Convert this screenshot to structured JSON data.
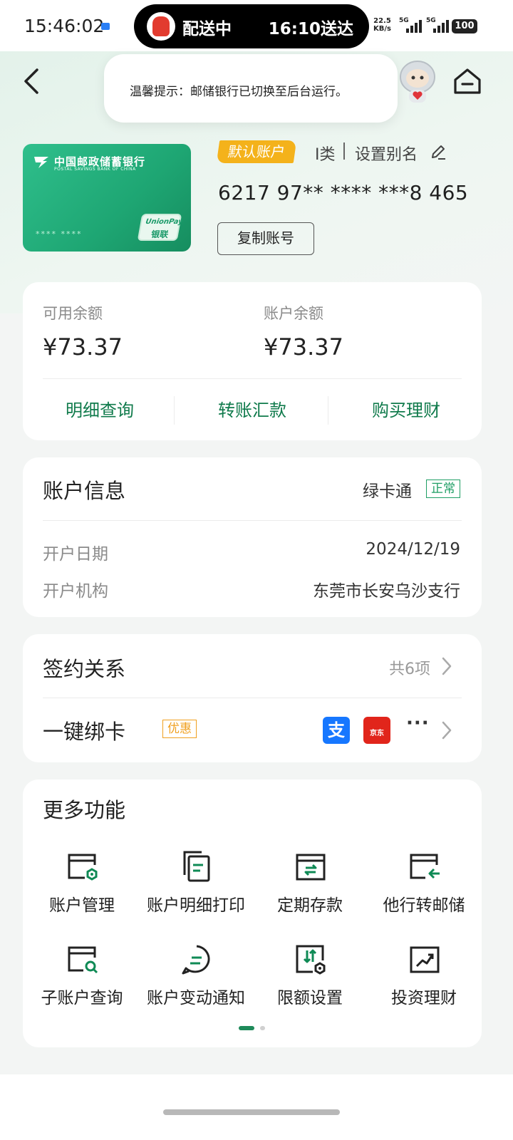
{
  "status_bar": {
    "time": "15:46:02",
    "delivery_label": "配送中",
    "delivery_eta": "16:10送达",
    "net_speed_value": "22.5",
    "net_speed_unit": "KB/s",
    "signal_1": "5G",
    "signal_2": "5G",
    "battery": "100"
  },
  "toast": {
    "text": "温馨提示：邮储银行已切换至后台运行。"
  },
  "card": {
    "bank_name": "中国邮政储蓄银行",
    "bank_name_en": "POSTAL SAVINGS BANK OF CHINA",
    "masked_digits": "**** ****",
    "unionpay_en": "UnionPay",
    "unionpay_cn": "银联",
    "default_badge": "默认账户",
    "account_class": "I类",
    "alias_link": "设置别名",
    "account_number": "6217 97** **** ***8 465",
    "copy_button": "复制账号"
  },
  "balance": {
    "available_label": "可用余额",
    "available_value": "¥73.37",
    "account_label": "账户余额",
    "account_value": "¥73.37",
    "actions": [
      "明细查询",
      "转账汇款",
      "购买理财"
    ]
  },
  "account_info": {
    "title": "账户信息",
    "card_type": "绿卡通",
    "status": "正常",
    "open_date_label": "开户日期",
    "open_date": "2024/12/19",
    "branch_label": "开户机构",
    "branch": "东莞市长安乌沙支行"
  },
  "contracts": {
    "title": "签约关系",
    "count": "共6项",
    "bind_title": "一键绑卡",
    "bind_tag": "优惠",
    "app_icons": [
      "alipay-icon",
      "jd-icon"
    ],
    "alipay_glyph": "支",
    "jd_label": "京东",
    "more": "···"
  },
  "more_features": {
    "title": "更多功能",
    "items": [
      {
        "label": "账户管理",
        "icon": "account-manage-icon"
      },
      {
        "label": "账户明细打印",
        "icon": "print-statement-icon"
      },
      {
        "label": "定期存款",
        "icon": "fixed-deposit-icon"
      },
      {
        "label": "他行转邮储",
        "icon": "transfer-in-icon"
      },
      {
        "label": "子账户查询",
        "icon": "sub-account-search-icon"
      },
      {
        "label": "账户变动通知",
        "icon": "notification-icon"
      },
      {
        "label": "限额设置",
        "icon": "limit-settings-icon"
      },
      {
        "label": "投资理财",
        "icon": "investment-icon"
      }
    ],
    "page_index": 1,
    "page_count": 2
  },
  "colors": {
    "brand_green": "#0f7a4b",
    "card_green": "#1ea673",
    "badge_yellow": "#f4b21b",
    "alipay_blue": "#1677ff",
    "jd_red": "#e1251b"
  }
}
